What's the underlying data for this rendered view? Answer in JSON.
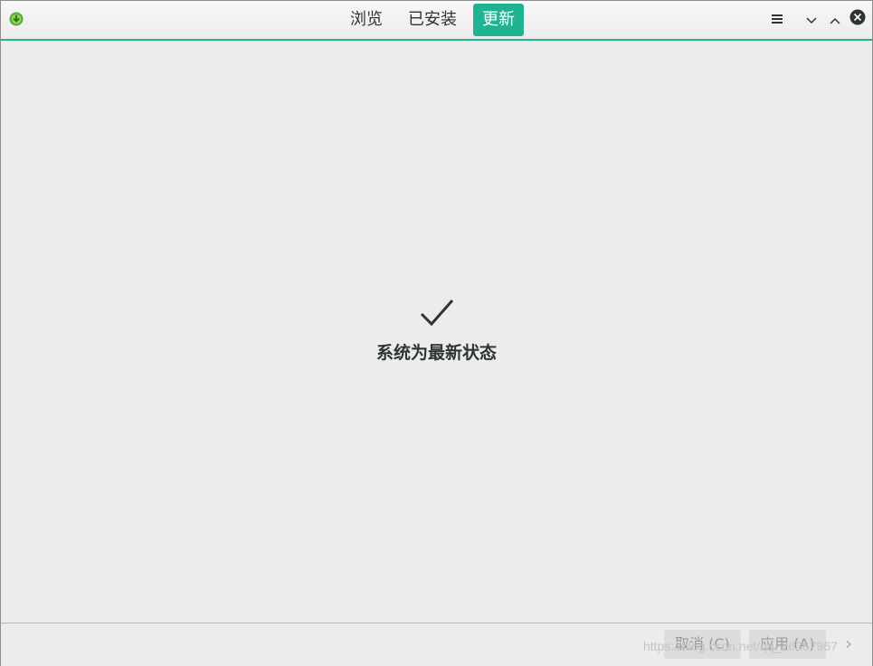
{
  "header": {
    "tabs": [
      {
        "label": "浏览",
        "active": false
      },
      {
        "label": "已安装",
        "active": false
      },
      {
        "label": "更新",
        "active": true
      }
    ],
    "icons": [
      "download-app-icon",
      "menu-icon",
      "minimize-icon",
      "maximize-icon",
      "close-icon"
    ],
    "accent_color": "#1fb392"
  },
  "main": {
    "status_text": "系统为最新状态",
    "status_icon": "checkmark-icon"
  },
  "footer": {
    "cancel_label": "取消 (C)",
    "apply_label": "应用 (A)",
    "watermark": "https://blog.csdn.net/qq_26367967"
  }
}
